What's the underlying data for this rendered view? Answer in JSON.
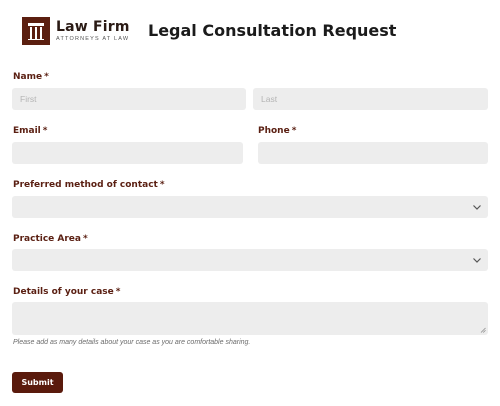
{
  "header": {
    "logo_name": "Law Firm",
    "logo_tagline": "ATTORNEYS AT LAW",
    "title": "Legal Consultation Request"
  },
  "form": {
    "required_marker": "*",
    "name": {
      "label": "Name",
      "first_placeholder": "First",
      "last_placeholder": "Last"
    },
    "email": {
      "label": "Email",
      "value": ""
    },
    "phone": {
      "label": "Phone",
      "value": ""
    },
    "contact_method": {
      "label": "Preferred method of contact",
      "selected": ""
    },
    "practice_area": {
      "label": "Practice Area",
      "selected": ""
    },
    "details": {
      "label": "Details of your case",
      "value": "",
      "hint": "Please add as many details about your case as you are comfortable sharing."
    },
    "submit_label": "Submit"
  },
  "colors": {
    "brand": "#5a1a0c",
    "field_bg": "#ededed",
    "label": "#5a1f12"
  },
  "icons": [
    "law-pillar-logo-icon",
    "chevron-down-icon",
    "resize-grip-icon"
  ]
}
